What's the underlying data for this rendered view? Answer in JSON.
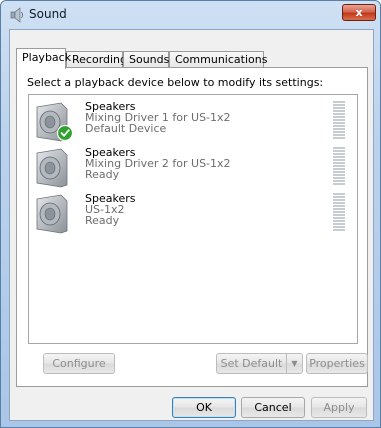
{
  "window": {
    "title": "Sound",
    "close_label": "x"
  },
  "tabs": [
    {
      "label": "Playback",
      "active": true
    },
    {
      "label": "Recording",
      "active": false
    },
    {
      "label": "Sounds",
      "active": false
    },
    {
      "label": "Communications",
      "active": false
    }
  ],
  "playback": {
    "instruction": "Select a playback device below to modify its settings:",
    "devices": [
      {
        "name": "Speakers",
        "driver": "Mixing Driver 1 for US-1x2",
        "status": "Default Device",
        "is_default": true
      },
      {
        "name": "Speakers",
        "driver": "Mixing Driver 2 for US-1x2",
        "status": "Ready",
        "is_default": false
      },
      {
        "name": "Speakers",
        "driver": "US-1x2",
        "status": "Ready",
        "is_default": false
      }
    ],
    "buttons": {
      "configure": "Configure",
      "set_default": "Set Default",
      "properties": "Properties"
    }
  },
  "dialog_buttons": {
    "ok": "OK",
    "cancel": "Cancel",
    "apply": "Apply"
  },
  "colors": {
    "check_green": "#2ea12e",
    "title_bar": "#bcd3ee",
    "close_red": "#c1381c"
  }
}
